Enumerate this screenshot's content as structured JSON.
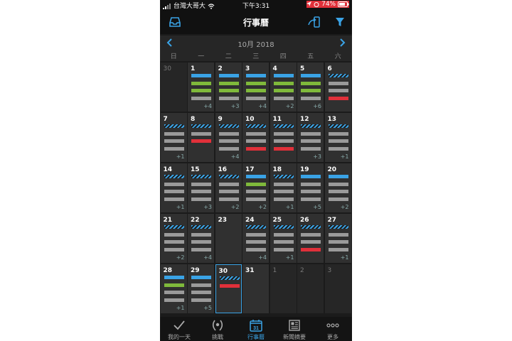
{
  "status_bar": {
    "carrier": "台灣大哥大",
    "time": "下午3:31",
    "battery": "74%"
  },
  "nav": {
    "title": "行事曆"
  },
  "calendar": {
    "month_label": "10月 2018",
    "weekdays": [
      "日",
      "一",
      "二",
      "三",
      "四",
      "五",
      "六"
    ],
    "days": [
      {
        "day": "30",
        "dim": true,
        "bars": [],
        "more": ""
      },
      {
        "day": "1",
        "bars": [
          "b",
          "g",
          "g",
          "y"
        ],
        "more": "+4"
      },
      {
        "day": "2",
        "bars": [
          "b",
          "g",
          "g",
          "y"
        ],
        "more": "+3"
      },
      {
        "day": "3",
        "bars": [
          "b",
          "g",
          "g",
          "y"
        ],
        "more": "+4"
      },
      {
        "day": "4",
        "bars": [
          "b",
          "g",
          "g",
          "y"
        ],
        "more": "+2"
      },
      {
        "day": "5",
        "bars": [
          "b",
          "g",
          "g",
          "y"
        ],
        "more": "+6"
      },
      {
        "day": "6",
        "bars": [
          "s",
          "y",
          "y",
          "r"
        ],
        "more": ""
      },
      {
        "day": "7",
        "bars": [
          "s",
          "y",
          "y",
          "y"
        ],
        "more": "+1"
      },
      {
        "day": "8",
        "bars": [
          "s",
          "y",
          "r"
        ],
        "more": ""
      },
      {
        "day": "9",
        "bars": [
          "s",
          "y",
          "y",
          "y"
        ],
        "more": "+4"
      },
      {
        "day": "10",
        "bars": [
          "s",
          "y",
          "y",
          "r"
        ],
        "more": ""
      },
      {
        "day": "11",
        "bars": [
          "s",
          "y",
          "y",
          "r"
        ],
        "more": ""
      },
      {
        "day": "12",
        "bars": [
          "s",
          "y",
          "y",
          "y"
        ],
        "more": "+3"
      },
      {
        "day": "13",
        "bars": [
          "s",
          "y",
          "y",
          "y"
        ],
        "more": "+1"
      },
      {
        "day": "14",
        "bars": [
          "s",
          "y",
          "y",
          "y"
        ],
        "more": "+1"
      },
      {
        "day": "15",
        "bars": [
          "s",
          "y",
          "y",
          "y"
        ],
        "more": "+3"
      },
      {
        "day": "16",
        "bars": [
          "s",
          "y",
          "y",
          "y"
        ],
        "more": "+2"
      },
      {
        "day": "17",
        "bars": [
          "b",
          "g",
          "y",
          "y"
        ],
        "more": "+2"
      },
      {
        "day": "18",
        "bars": [
          "s",
          "y",
          "y",
          "y"
        ],
        "more": "+1"
      },
      {
        "day": "19",
        "bars": [
          "b",
          "y",
          "y",
          "y"
        ],
        "more": "+5"
      },
      {
        "day": "20",
        "bars": [
          "b",
          "y",
          "y",
          "y"
        ],
        "more": "+2"
      },
      {
        "day": "21",
        "bars": [
          "s",
          "y",
          "y",
          "y"
        ],
        "more": "+2"
      },
      {
        "day": "22",
        "bars": [
          "s",
          "y",
          "y",
          "y"
        ],
        "more": "+4"
      },
      {
        "day": "23",
        "bars": [],
        "more": ""
      },
      {
        "day": "24",
        "bars": [
          "s",
          "y",
          "y",
          "y"
        ],
        "more": "+4"
      },
      {
        "day": "25",
        "bars": [
          "s",
          "y",
          "y",
          "y"
        ],
        "more": "+1"
      },
      {
        "day": "26",
        "bars": [
          "s",
          "y",
          "y",
          "r"
        ],
        "more": ""
      },
      {
        "day": "27",
        "bars": [
          "s",
          "y",
          "y",
          "y"
        ],
        "more": "+1"
      },
      {
        "day": "28",
        "bars": [
          "b",
          "g",
          "y",
          "y"
        ],
        "more": "+1"
      },
      {
        "day": "29",
        "bars": [
          "b",
          "y",
          "y",
          "y"
        ],
        "more": "+5"
      },
      {
        "day": "30",
        "today": true,
        "bars": [
          "s",
          "r"
        ],
        "more": ""
      },
      {
        "day": "31",
        "bars": [],
        "more": ""
      },
      {
        "day": "1",
        "dim": true,
        "bars": [],
        "more": ""
      },
      {
        "day": "2",
        "dim": true,
        "bars": [],
        "more": ""
      },
      {
        "day": "3",
        "dim": true,
        "bars": [],
        "more": ""
      }
    ]
  },
  "tabs": [
    {
      "label": "我的一天",
      "icon": "checkmark-icon"
    },
    {
      "label": "挑戰",
      "icon": "laurel-icon"
    },
    {
      "label": "行事曆",
      "icon": "calendar-icon",
      "active": true,
      "icon_text": "31"
    },
    {
      "label": "新聞摘要",
      "icon": "newsfeed-icon"
    },
    {
      "label": "更多",
      "icon": "more-icon"
    }
  ],
  "colors": {
    "accent": "#3aa3e6",
    "green": "#7fb93b",
    "gray": "#9a9a9a",
    "red": "#e0303a"
  }
}
